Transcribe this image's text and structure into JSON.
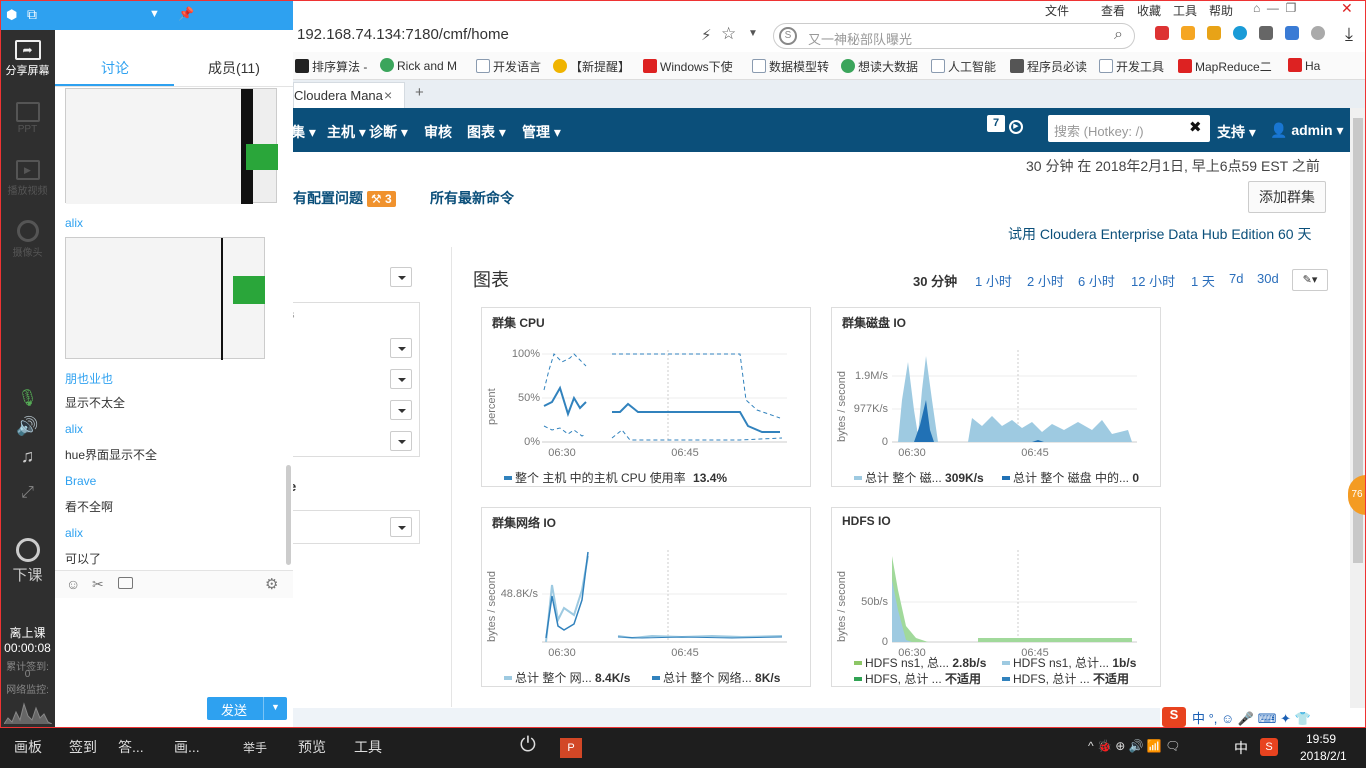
{
  "browser": {
    "menu": [
      "文件",
      "查看",
      "收藏",
      "工具",
      "帮助"
    ],
    "url": "192.168.74.134:7180/cmf/home",
    "search_placeholder": "又一神秘部队曝光",
    "bookmarks": [
      {
        "label": "排序算法 -",
        "color": "#222"
      },
      {
        "label": "Rick and M",
        "color": "#3ba55c"
      },
      {
        "label": "开发语言",
        "color": "#8a9bb0"
      },
      {
        "label": "【新提醒】",
        "color": "#f0b400"
      },
      {
        "label": "Windows下使",
        "color": "#d22"
      },
      {
        "label": "数据模型转",
        "color": "#8a9bb0"
      },
      {
        "label": "想读大数据",
        "color": "#3ba55c"
      },
      {
        "label": "人工智能",
        "color": "#8a9bb0"
      },
      {
        "label": "程序员必读",
        "color": "#555"
      },
      {
        "label": "开发工具",
        "color": "#8a9bb0"
      },
      {
        "label": "MapReduce二",
        "color": "#d22"
      },
      {
        "label": "Ha",
        "color": "#d22"
      }
    ],
    "tab_title": "Cloudera Mana",
    "tab_close": "×",
    "tab_new": "+"
  },
  "cm": {
    "nav": [
      "集",
      "主机",
      "诊断",
      "审核",
      "图表",
      "管理"
    ],
    "badge": "7",
    "search_placeholder": "搜索 (Hotkey: /)",
    "support": "支持",
    "user": "admin",
    "timestamp": "30 分钟 在 2018年2月1日, 早上6点59 EST 之前",
    "config_issues": "有配置问题",
    "config_count": "3",
    "recent_commands": "所有最新命令",
    "add_cluster": "添加群集",
    "trial": "试用 Cloudera Enterprise Data Hub Edition 60 天",
    "charts_heading": "图表",
    "ranges": [
      "30 分钟",
      "1 小时",
      "2 小时",
      "6 小时",
      "12 小时",
      "1 天",
      "7d",
      "30d"
    ],
    "cut_letter_1": "s",
    "cut_letter_2": "e"
  },
  "charts": {
    "cpu": {
      "title": "群集 CPU",
      "ylabel": "percent",
      "yticks": [
        "100%",
        "50%",
        "0%"
      ],
      "xticks": [
        "06:30",
        "06:45"
      ],
      "legend_label": "整个 主机 中的主机 CPU 使用率",
      "legend_value": "13.4%"
    },
    "disk": {
      "title": "群集磁盘 IO",
      "ylabel": "bytes / second",
      "yticks": [
        "1.9M/s",
        "977K/s",
        "0"
      ],
      "xticks": [
        "06:30",
        "06:45"
      ],
      "legend1_label": "总计 整个 磁...",
      "legend1_value": "309K/s",
      "legend2_label": "总计 整个 磁盘 中的...",
      "legend2_value": "0"
    },
    "network": {
      "title": "群集网络 IO",
      "ylabel": "bytes / second",
      "yticks": [
        "48.8K/s"
      ],
      "xticks": [
        "06:30",
        "06:45"
      ],
      "legend1_label": "总计 整个 网...",
      "legend1_value": "8.4K/s",
      "legend2_label": "总计 整个 网络...",
      "legend2_value": "8K/s"
    },
    "hdfs": {
      "title": "HDFS IO",
      "ylabel": "bytes / second",
      "yticks": [
        "50b/s",
        "0"
      ],
      "xticks": [
        "06:30",
        "06:45"
      ],
      "legends": [
        {
          "label": "HDFS ns1, 总...",
          "value": "2.8b/s",
          "color": "#8cc665"
        },
        {
          "label": "HDFS ns1, 总计...",
          "value": "1b/s",
          "color": "#9ecae1"
        },
        {
          "label": "HDFS, 总计 ...",
          "value": "不适用",
          "color": "#31a354"
        },
        {
          "label": "HDFS, 总计 ...",
          "value": "不适用",
          "color": "#3182bd"
        }
      ]
    }
  },
  "sidebar": {
    "share": "分享屏幕",
    "ppt": "PPT",
    "video": "播放视频",
    "camera": "摄像头",
    "end_class": "下课",
    "status": "离上课",
    "timer": "00:00:08",
    "count_label": "累计签到:",
    "count": "0",
    "net_label": "网络监控:"
  },
  "chat": {
    "tab_discuss": "讨论",
    "tab_members": "成员(11)",
    "messages": [
      {
        "name": "alix",
        "text": ""
      },
      {
        "name": "朋也业也",
        "text": "显示不太全"
      },
      {
        "name": "alix",
        "text": "hue界面显示不全"
      },
      {
        "name": "Brave",
        "text": "看不全啊"
      },
      {
        "name": "alix",
        "text": "可以了"
      }
    ],
    "send": "发送"
  },
  "taskbar": {
    "items": [
      "画板",
      "签到",
      "答...",
      "画...",
      "举手",
      "预览",
      "工具"
    ],
    "ime_lang": "中",
    "time": "19:59",
    "date": "2018/2/1"
  },
  "accent": {
    "cloudera_nav": "#0b4f7a",
    "chat_blue": "#2ea1f0",
    "badge_orange": "#f0922e",
    "link": "#2a6ebb"
  }
}
